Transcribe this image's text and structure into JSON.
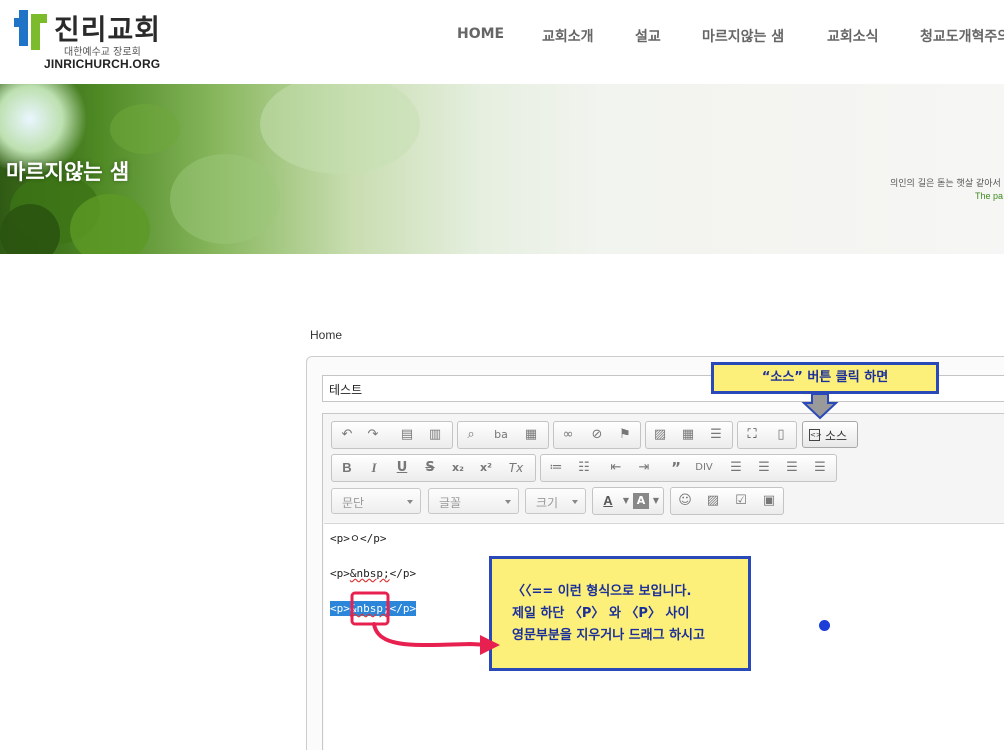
{
  "logo": {
    "name_kr": "진리교회",
    "subtitle": "대한예수교 장로회",
    "name_en": "JINRICHURCH.ORG"
  },
  "nav": {
    "items": [
      {
        "label": "HOME"
      },
      {
        "label": "교회소개"
      },
      {
        "label": "설교"
      },
      {
        "label": "마르지않는 샘"
      },
      {
        "label": "교회소식"
      },
      {
        "label": "청교도개혁주의"
      }
    ]
  },
  "banner": {
    "title": "마르지않는 샘",
    "quote_kr": "의인의 길은 돋는 햇살 같아서",
    "quote_en": "The pa"
  },
  "breadcrumb": "Home",
  "post": {
    "title_value": "테스트"
  },
  "toolbar": {
    "combo_format": "문단",
    "combo_font": "글꼴",
    "combo_size": "크기",
    "source_label": "소스",
    "icons_row1": [
      "undo-icon",
      "redo-icon",
      "paste-text-icon",
      "paste-word-icon",
      "find-icon",
      "replace-icon",
      "select-all-icon",
      "link-icon",
      "unlink-icon",
      "anchor-icon",
      "image-icon",
      "table-icon",
      "horizontal-rule-icon",
      "maximize-icon",
      "show-blocks-icon"
    ],
    "icons_row2": [
      "bold-icon",
      "italic-icon",
      "underline-icon",
      "strike-icon",
      "subscript-icon",
      "superscript-icon",
      "remove-format-icon",
      "numbered-list-icon",
      "bulleted-list-icon",
      "outdent-icon",
      "indent-icon",
      "blockquote-icon",
      "create-div-icon",
      "align-left-icon",
      "align-center-icon",
      "align-right-icon",
      "justify-icon"
    ],
    "glyphs_row2": [
      "B",
      "I",
      "U",
      "S",
      "x₂",
      "x²",
      "Tx"
    ],
    "text_color_glyph": "A",
    "bg_color_glyph": "A"
  },
  "editor": {
    "lines": [
      "<p>ㅇ</p>",
      "<p>&nbsp;</p>",
      "<p>&nbsp;</p>"
    ],
    "line3_prefix": "<p>",
    "line3_entity": "&nbsp;",
    "line3_suffix": "</p>",
    "line2_prefix": "<p>",
    "line2_entity": "&nbsp;",
    "line2_suffix": "</p>"
  },
  "annotations": {
    "top_note": "“소스” 버튼 클릭 하면",
    "box_lines": [
      "〈〈== 이런 형식으로 보입니다.",
      "제일 하단 〈P〉 와 〈P〉 사이",
      "영문부분을 지우거나 드래그 하시고"
    ]
  },
  "colors": {
    "highlight": "#2b86d9",
    "note_bg": "#fdf07a",
    "note_border": "#2a49b8",
    "arrow": "#e8204f",
    "logo_blue": "#1f74c8",
    "logo_green": "#7cbc2c"
  }
}
